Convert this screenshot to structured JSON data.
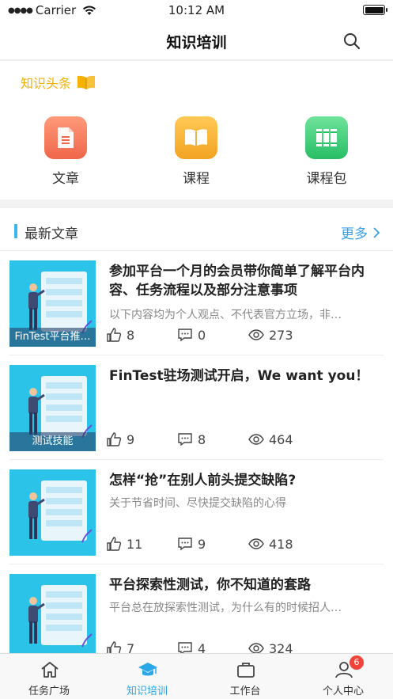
{
  "status_bar": {
    "carrier": "Carrier",
    "time": "10:12 AM"
  },
  "nav": {
    "title": "知识培训"
  },
  "headline": {
    "label": "知识头条"
  },
  "categories": [
    {
      "label": "文章",
      "icon": "document-icon",
      "color": "#f0664a"
    },
    {
      "label": "课程",
      "icon": "open-book-icon",
      "color": "#f2a323"
    },
    {
      "label": "课程包",
      "icon": "books-icon",
      "color": "#28be66"
    }
  ],
  "latest": {
    "title": "最新文章",
    "more_label": "更多",
    "articles": [
      {
        "title": "参加平台一个月的会员带你简单了解平台内容、任务流程以及部分注意事项",
        "summary": "以下内容均为个人观点、不代表官方立场，非…",
        "thumb_label": "FinTest平台推…",
        "likes": "8",
        "comments": "0",
        "views": "273"
      },
      {
        "title": "FinTest驻场测试开启，We want you！",
        "summary": "",
        "thumb_label": "测试技能",
        "likes": "9",
        "comments": "8",
        "views": "464"
      },
      {
        "title": "怎样“抢”在别人前头提交缺陷?",
        "summary": "关于节省时间、尽快提交缺陷的心得",
        "thumb_label": "",
        "likes": "11",
        "comments": "9",
        "views": "418"
      },
      {
        "title": "平台探索性测试，你不知道的套路",
        "summary": "平台总在放探索性测试，为什么有的时候招人…",
        "thumb_label": "",
        "likes": "7",
        "comments": "4",
        "views": "324"
      }
    ]
  },
  "tabs": [
    {
      "label": "任务广场",
      "icon": "home-icon",
      "active": false
    },
    {
      "label": "知识培训",
      "icon": "graduation-cap-icon",
      "active": true
    },
    {
      "label": "工作台",
      "icon": "briefcase-icon",
      "active": false
    },
    {
      "label": "个人中心",
      "icon": "person-icon",
      "active": false,
      "badge": "6"
    }
  ],
  "colors": {
    "accent": "#2aa7e8",
    "headline": "#f5b100",
    "badge": "#f0433a"
  }
}
